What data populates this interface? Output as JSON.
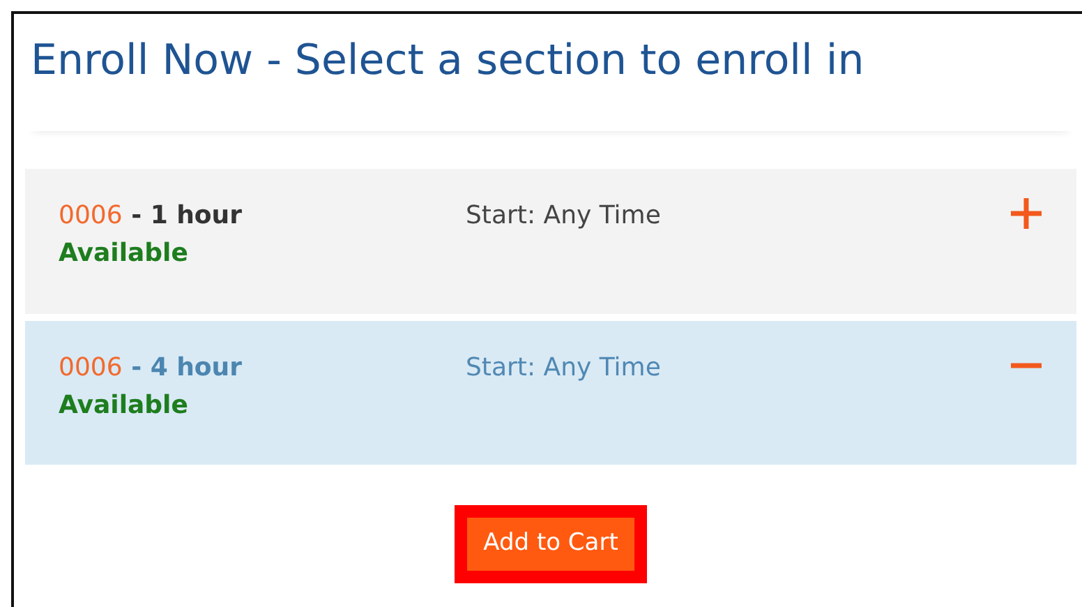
{
  "title": "Enroll Now - Select a section to enroll in",
  "sections": [
    {
      "code": "0006",
      "name": "- 1 hour",
      "status": "Available",
      "start": "Start: Any Time",
      "expanded": false
    },
    {
      "code": "0006",
      "name": "- 4 hour",
      "status": "Available",
      "start": "Start: Any Time",
      "expanded": true
    }
  ],
  "button": {
    "label": "Add to Cart",
    "highlighted": true
  }
}
